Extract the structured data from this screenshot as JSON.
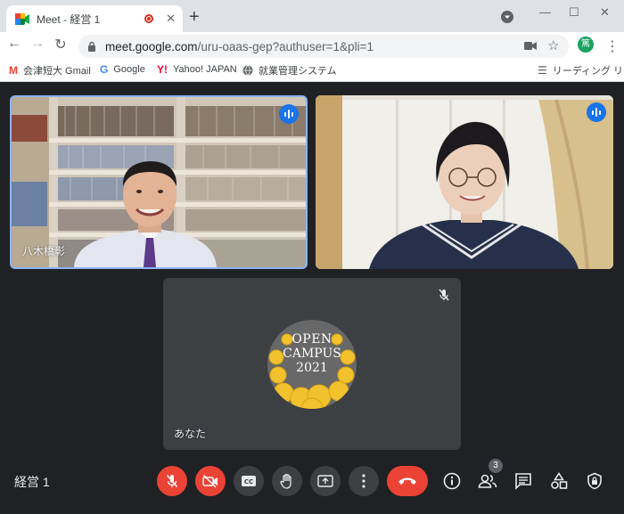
{
  "browser": {
    "tab_title": "Meet - 経営 1",
    "url_host": "meet.google.com",
    "url_path": "/uru-oaas-gep?authuser=1&pli=1",
    "profile_initial": "篤",
    "bookmarks": [
      {
        "label": "会津短大 Gmail",
        "icon": "gmail-icon",
        "icon_text": "M"
      },
      {
        "label": "Google",
        "icon": "google-icon",
        "icon_text": "G"
      },
      {
        "label": "Yahoo! JAPAN",
        "icon": "yahoo-icon",
        "icon_text": "Y!"
      },
      {
        "label": "就業管理システム",
        "icon": "globe-icon",
        "icon_text": ""
      }
    ],
    "reading_list": "リーディング リスト"
  },
  "meet": {
    "meeting_title": "経営 1",
    "participants_count": "3",
    "tiles": [
      {
        "name": "八木橋彰",
        "speaking": true
      },
      {
        "name": "",
        "speaking": true
      },
      {
        "name": "あなた",
        "muted": true
      }
    ],
    "logo": {
      "line1": "OPEN",
      "line2": "CAMPUS",
      "line3": "2021"
    }
  },
  "colors": {
    "accent": "#1a73e8",
    "danger": "#ea4335",
    "meet_bg": "#202124"
  }
}
